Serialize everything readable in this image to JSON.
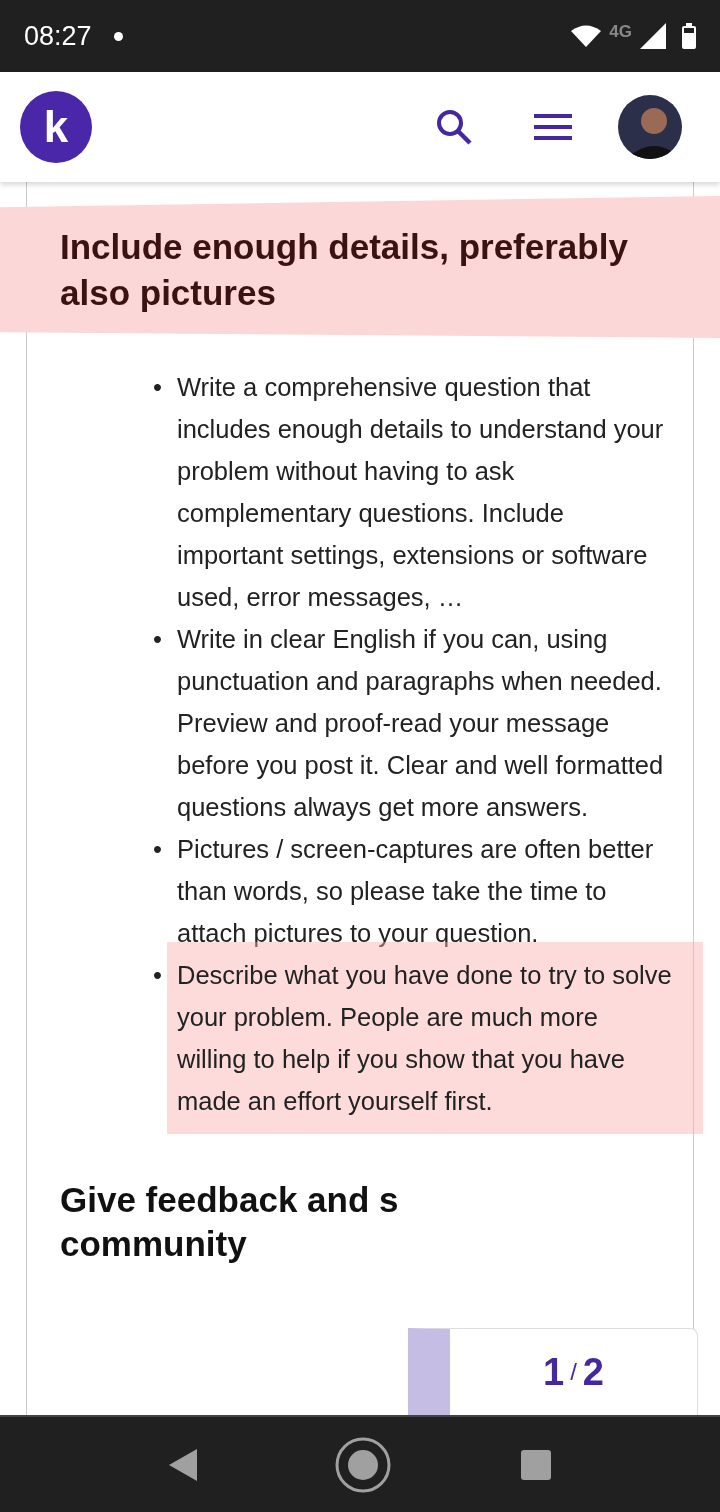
{
  "status_bar": {
    "time": "08:27",
    "network": "4G"
  },
  "header": {
    "logo_letter": "k"
  },
  "section": {
    "marker": "•",
    "title": "Include enough details, preferably also pictures",
    "highlighted": true,
    "items": [
      {
        "text": "Write a comprehensive question that includes enough details to understand your problem without having to ask complementary questions. Include important settings, extensions or software used, error messages, …",
        "highlighted": false
      },
      {
        "text": "Write in clear English if you can, using punctuation and paragraphs when needed. Preview and proof-read your message before you post it. Clear and well formatted questions always get more answers.",
        "highlighted": false
      },
      {
        "text": "Pictures / screen-captures are often better than words, so please take the time to attach pictures to your question.",
        "highlighted": false
      },
      {
        "text": "Describe what you have done to try to solve your problem. People are much more willing to help if you show that you have made an effort yourself first.",
        "highlighted": true
      }
    ]
  },
  "next_section": {
    "title_lines": [
      "Give feedback and s",
      "community"
    ]
  },
  "pager": {
    "current": "1",
    "separator": "/",
    "total": "2"
  }
}
